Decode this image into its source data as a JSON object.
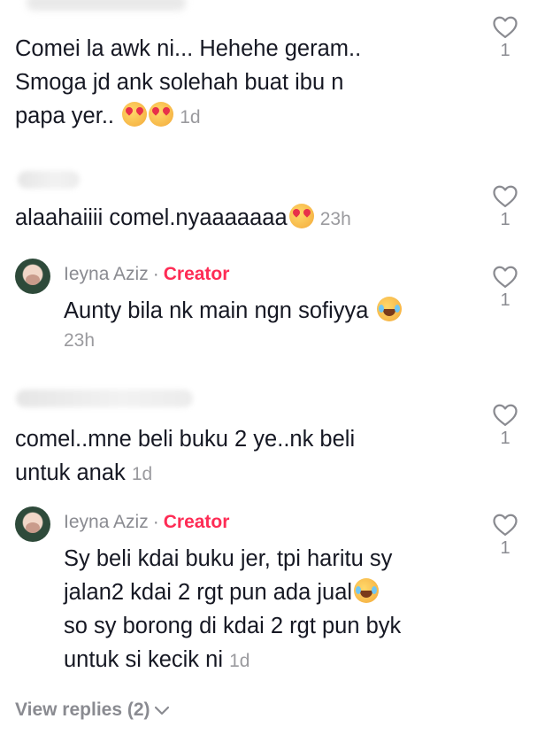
{
  "comments": [
    {
      "text": "Comei la awk ni... Hehehe geram.. Smoga jd ank solehah buat ibu n papa yer..",
      "lines": [
        "Comei la awk ni... Hehehe geram..",
        "Smoga jd ank solehah buat ibu n",
        "papa yer.."
      ],
      "emojis": [
        "smiling-face-with-hearts",
        "smiling-face-with-hearts"
      ],
      "time": "1d",
      "likes": "1"
    },
    {
      "text": "alaahaiiii comel.nyaaaaaaa",
      "emojis": [
        "smiling-face-with-hearts"
      ],
      "time": "23h",
      "likes": "1"
    },
    {
      "author": "Ieyna Aziz",
      "badge": "Creator",
      "text": "Aunty bila nk main ngn sofiyya",
      "emojis": [
        "face-with-tears-of-joy"
      ],
      "time": "23h",
      "likes": "1"
    },
    {
      "lines": [
        "comel..mne beli buku 2 ye..nk beli",
        "untuk anak"
      ],
      "time": "1d",
      "likes": "1"
    },
    {
      "author": "Ieyna Aziz",
      "badge": "Creator",
      "lines": [
        "Sy beli kdai buku jer, tpi haritu sy",
        "jalan2 kdai 2 rgt pun ada jual",
        "so sy borong di kdai 2 rgt pun byk",
        "untuk si kecik ni"
      ],
      "emojis": [
        "face-with-tears-of-joy"
      ],
      "time": "1d",
      "likes": "1"
    }
  ],
  "separator": "·",
  "view_replies": "View replies (2)",
  "colors": {
    "text": "#161823",
    "muted": "#8a8b91",
    "creator": "#fe2c55"
  }
}
